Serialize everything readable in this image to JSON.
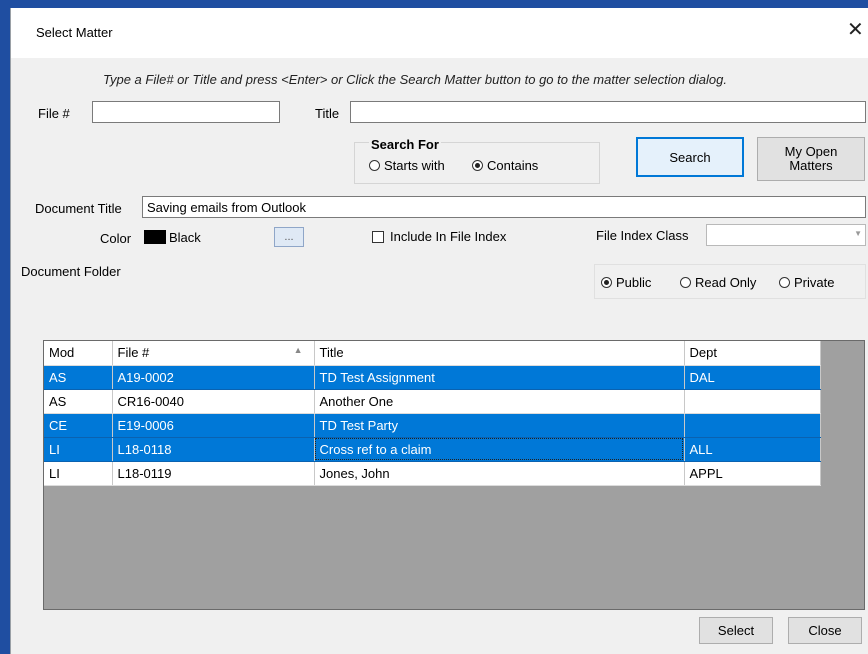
{
  "window": {
    "title": "Select Matter",
    "close_glyph": "✕"
  },
  "hint": "Type a File# or Title and press <Enter> or Click the Search Matter button to go to the matter selection dialog.",
  "file_no": {
    "label": "File #",
    "value": ""
  },
  "title_field": {
    "label": "Title",
    "value": ""
  },
  "search_for": {
    "label": "Search For",
    "options": [
      {
        "label": "Starts with",
        "selected": false
      },
      {
        "label": "Contains",
        "selected": true
      }
    ]
  },
  "buttons": {
    "search": "Search",
    "my_open_matters": "My Open Matters",
    "select": "Select",
    "close": "Close"
  },
  "document_title": {
    "label": "Document Title",
    "value": "Saving emails from Outlook"
  },
  "color": {
    "label": "Color",
    "value": "Black",
    "swatch": "#000000",
    "ellipsis": "..."
  },
  "include_in_file_index": {
    "label": "Include In File Index",
    "checked": false
  },
  "file_index_class": {
    "label": "File Index Class",
    "value": ""
  },
  "document_folder": {
    "label": "Document Folder"
  },
  "visibility": {
    "options": [
      {
        "label": "Public",
        "selected": true
      },
      {
        "label": "Read Only",
        "selected": false
      },
      {
        "label": "Private",
        "selected": false
      }
    ]
  },
  "grid": {
    "columns": [
      "Mod",
      "File #",
      "Title",
      "Dept"
    ],
    "sorted_column": "File #",
    "sort_direction": "ascending",
    "rows": [
      {
        "mod": "AS",
        "file": "A19-0002",
        "title": "TD Test Assignment",
        "dept": "DAL",
        "selected": true
      },
      {
        "mod": "AS",
        "file": "CR16-0040",
        "title": "Another One",
        "dept": "",
        "selected": false
      },
      {
        "mod": "CE",
        "file": "E19-0006",
        "title": "TD Test Party",
        "dept": "",
        "selected": true
      },
      {
        "mod": "LI",
        "file": "L18-0118",
        "title": "Cross ref to a claim",
        "dept": "ALL",
        "selected": true
      },
      {
        "mod": "LI",
        "file": "L18-0119",
        "title": "Jones, John",
        "dept": "APPL",
        "selected": false
      }
    ]
  },
  "colors": {
    "selection": "#0078d7",
    "frame": "#1f4ea1",
    "dialog_bg": "#f0f0f0"
  }
}
